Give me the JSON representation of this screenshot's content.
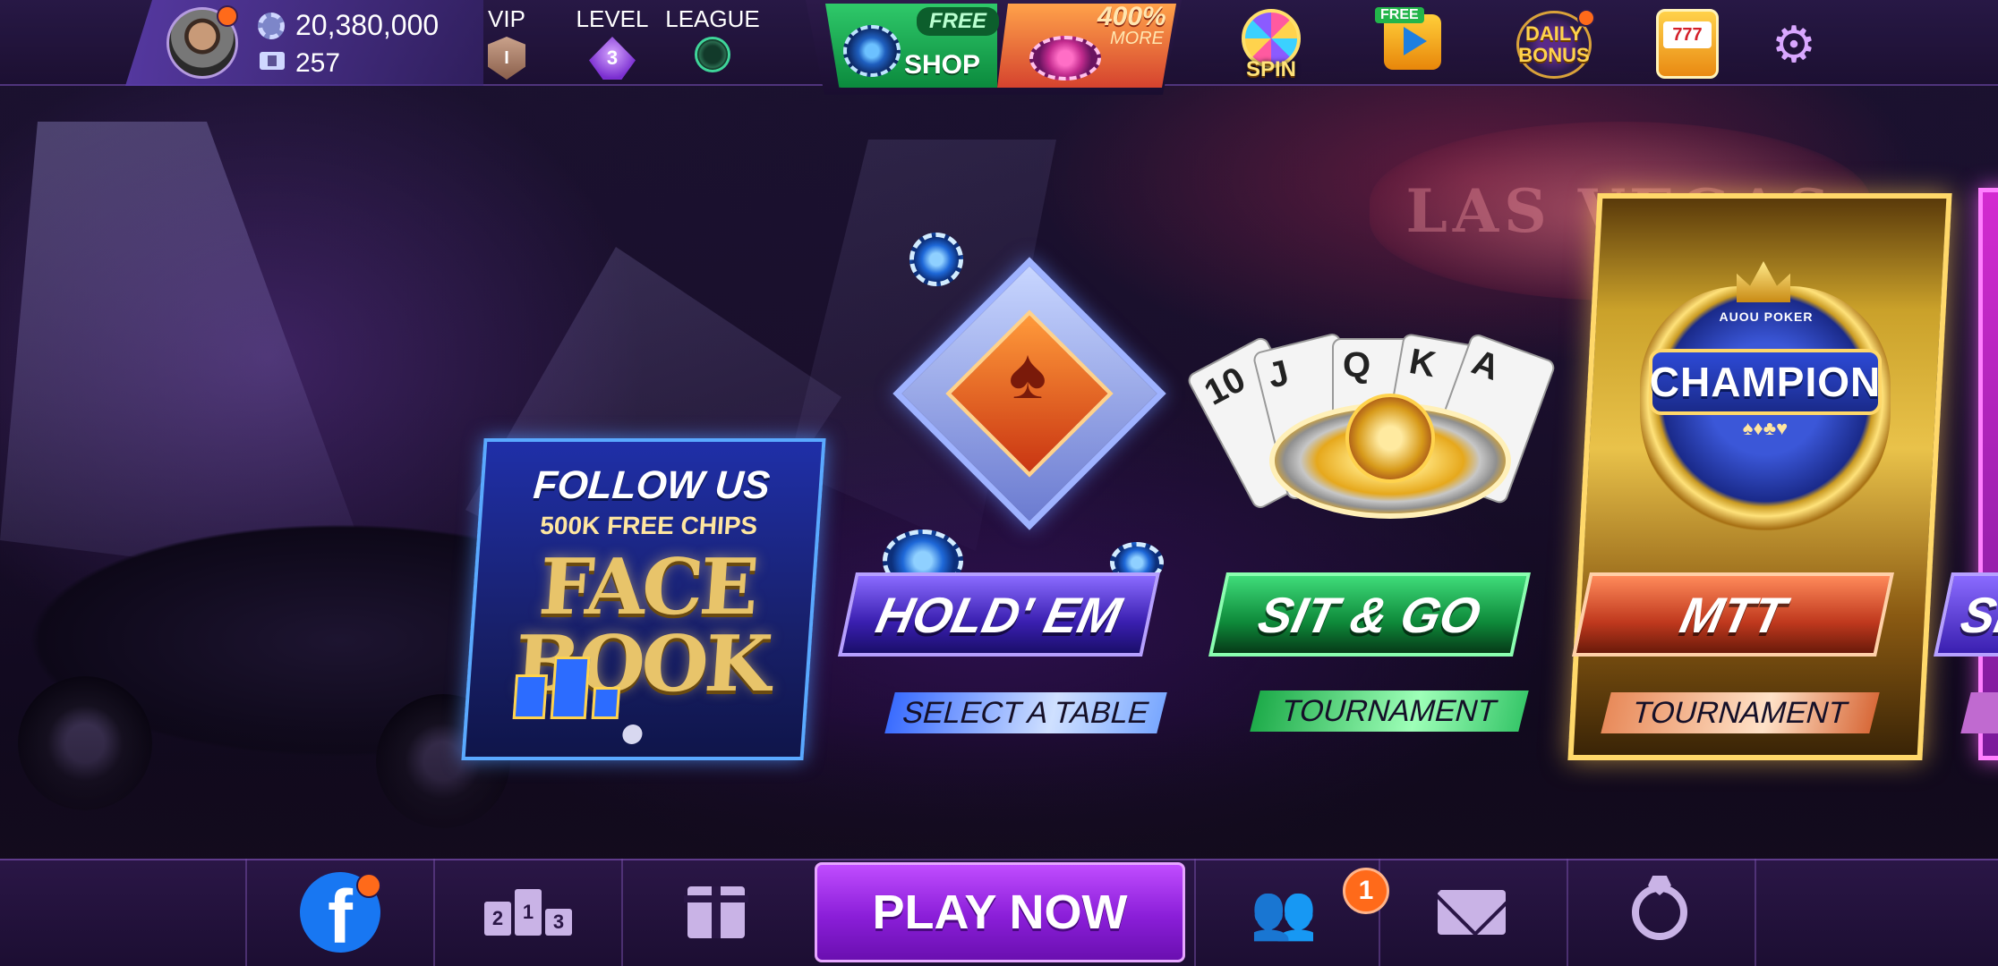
{
  "topbar": {
    "chips": "20,380,000",
    "tickets": "257",
    "vip": {
      "label": "VIP",
      "value": "I"
    },
    "level": {
      "label": "LEVEL",
      "value": "3"
    },
    "league": {
      "label": "LEAGUE"
    },
    "shop": {
      "badge": "FREE",
      "label": "SHOP"
    },
    "promo": {
      "percent": "400%",
      "label": "MORE"
    },
    "spin_label": "SPIN",
    "video_badge": "FREE",
    "daily_bonus_label": "DAILY BONUS",
    "slot_symbol": "777"
  },
  "background": {
    "sign_text": "LAS VEGAS"
  },
  "promo_card": {
    "title": "FOLLOW US",
    "subtitle": "500K FREE CHIPS",
    "brand_line1": "FACE",
    "brand_line2": "BOOK"
  },
  "games": [
    {
      "id": "holdem",
      "title": "HOLD' EM",
      "subtitle": "SELECT A TABLE"
    },
    {
      "id": "sitgo",
      "title": "SIT & GO",
      "subtitle": "TOURNAMENT"
    },
    {
      "id": "mtt",
      "title": "MTT",
      "subtitle": "TOURNAMENT",
      "brand": "AUOU POKER",
      "emblem": "CHAMPION",
      "suits": "♠♦♣♥"
    },
    {
      "id": "next",
      "title": "SI"
    }
  ],
  "sitgo_cards": [
    "10",
    "J",
    "Q",
    "K",
    "A"
  ],
  "bottombar": {
    "facebook_letter": "f",
    "podium": [
      "2",
      "1",
      "3"
    ],
    "play_now": "PLAY NOW",
    "friends_badge": "1"
  },
  "colors": {
    "accent_purple": "#8a1ed8",
    "notification_orange": "#ff6a1a",
    "facebook_blue": "#1877f2"
  },
  "icons": [
    "avatar",
    "chips-icon",
    "ticket-icon",
    "vip-badge",
    "level-badge",
    "league-badge",
    "spin-icon",
    "video-reward-icon",
    "daily-bonus-icon",
    "slot-machine-icon",
    "gear-icon",
    "facebook-icon",
    "leaderboard-icon",
    "gift-icon",
    "friends-icon",
    "mail-icon",
    "ring-icon"
  ]
}
